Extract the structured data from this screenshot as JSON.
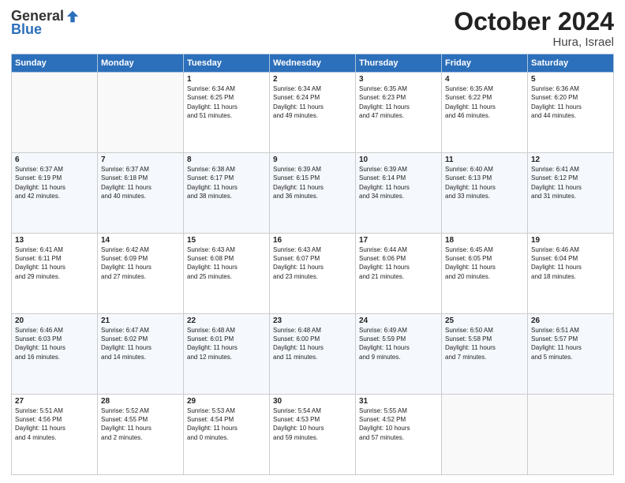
{
  "logo": {
    "general": "General",
    "blue": "Blue"
  },
  "title": "October 2024",
  "location": "Hura, Israel",
  "days_header": [
    "Sunday",
    "Monday",
    "Tuesday",
    "Wednesday",
    "Thursday",
    "Friday",
    "Saturday"
  ],
  "weeks": [
    [
      {
        "day": "",
        "content": ""
      },
      {
        "day": "",
        "content": ""
      },
      {
        "day": "1",
        "content": "Sunrise: 6:34 AM\nSunset: 6:25 PM\nDaylight: 11 hours\nand 51 minutes."
      },
      {
        "day": "2",
        "content": "Sunrise: 6:34 AM\nSunset: 6:24 PM\nDaylight: 11 hours\nand 49 minutes."
      },
      {
        "day": "3",
        "content": "Sunrise: 6:35 AM\nSunset: 6:23 PM\nDaylight: 11 hours\nand 47 minutes."
      },
      {
        "day": "4",
        "content": "Sunrise: 6:35 AM\nSunset: 6:22 PM\nDaylight: 11 hours\nand 46 minutes."
      },
      {
        "day": "5",
        "content": "Sunrise: 6:36 AM\nSunset: 6:20 PM\nDaylight: 11 hours\nand 44 minutes."
      }
    ],
    [
      {
        "day": "6",
        "content": "Sunrise: 6:37 AM\nSunset: 6:19 PM\nDaylight: 11 hours\nand 42 minutes."
      },
      {
        "day": "7",
        "content": "Sunrise: 6:37 AM\nSunset: 6:18 PM\nDaylight: 11 hours\nand 40 minutes."
      },
      {
        "day": "8",
        "content": "Sunrise: 6:38 AM\nSunset: 6:17 PM\nDaylight: 11 hours\nand 38 minutes."
      },
      {
        "day": "9",
        "content": "Sunrise: 6:39 AM\nSunset: 6:15 PM\nDaylight: 11 hours\nand 36 minutes."
      },
      {
        "day": "10",
        "content": "Sunrise: 6:39 AM\nSunset: 6:14 PM\nDaylight: 11 hours\nand 34 minutes."
      },
      {
        "day": "11",
        "content": "Sunrise: 6:40 AM\nSunset: 6:13 PM\nDaylight: 11 hours\nand 33 minutes."
      },
      {
        "day": "12",
        "content": "Sunrise: 6:41 AM\nSunset: 6:12 PM\nDaylight: 11 hours\nand 31 minutes."
      }
    ],
    [
      {
        "day": "13",
        "content": "Sunrise: 6:41 AM\nSunset: 6:11 PM\nDaylight: 11 hours\nand 29 minutes."
      },
      {
        "day": "14",
        "content": "Sunrise: 6:42 AM\nSunset: 6:09 PM\nDaylight: 11 hours\nand 27 minutes."
      },
      {
        "day": "15",
        "content": "Sunrise: 6:43 AM\nSunset: 6:08 PM\nDaylight: 11 hours\nand 25 minutes."
      },
      {
        "day": "16",
        "content": "Sunrise: 6:43 AM\nSunset: 6:07 PM\nDaylight: 11 hours\nand 23 minutes."
      },
      {
        "day": "17",
        "content": "Sunrise: 6:44 AM\nSunset: 6:06 PM\nDaylight: 11 hours\nand 21 minutes."
      },
      {
        "day": "18",
        "content": "Sunrise: 6:45 AM\nSunset: 6:05 PM\nDaylight: 11 hours\nand 20 minutes."
      },
      {
        "day": "19",
        "content": "Sunrise: 6:46 AM\nSunset: 6:04 PM\nDaylight: 11 hours\nand 18 minutes."
      }
    ],
    [
      {
        "day": "20",
        "content": "Sunrise: 6:46 AM\nSunset: 6:03 PM\nDaylight: 11 hours\nand 16 minutes."
      },
      {
        "day": "21",
        "content": "Sunrise: 6:47 AM\nSunset: 6:02 PM\nDaylight: 11 hours\nand 14 minutes."
      },
      {
        "day": "22",
        "content": "Sunrise: 6:48 AM\nSunset: 6:01 PM\nDaylight: 11 hours\nand 12 minutes."
      },
      {
        "day": "23",
        "content": "Sunrise: 6:48 AM\nSunset: 6:00 PM\nDaylight: 11 hours\nand 11 minutes."
      },
      {
        "day": "24",
        "content": "Sunrise: 6:49 AM\nSunset: 5:59 PM\nDaylight: 11 hours\nand 9 minutes."
      },
      {
        "day": "25",
        "content": "Sunrise: 6:50 AM\nSunset: 5:58 PM\nDaylight: 11 hours\nand 7 minutes."
      },
      {
        "day": "26",
        "content": "Sunrise: 6:51 AM\nSunset: 5:57 PM\nDaylight: 11 hours\nand 5 minutes."
      }
    ],
    [
      {
        "day": "27",
        "content": "Sunrise: 5:51 AM\nSunset: 4:56 PM\nDaylight: 11 hours\nand 4 minutes."
      },
      {
        "day": "28",
        "content": "Sunrise: 5:52 AM\nSunset: 4:55 PM\nDaylight: 11 hours\nand 2 minutes."
      },
      {
        "day": "29",
        "content": "Sunrise: 5:53 AM\nSunset: 4:54 PM\nDaylight: 11 hours\nand 0 minutes."
      },
      {
        "day": "30",
        "content": "Sunrise: 5:54 AM\nSunset: 4:53 PM\nDaylight: 10 hours\nand 59 minutes."
      },
      {
        "day": "31",
        "content": "Sunrise: 5:55 AM\nSunset: 4:52 PM\nDaylight: 10 hours\nand 57 minutes."
      },
      {
        "day": "",
        "content": ""
      },
      {
        "day": "",
        "content": ""
      }
    ]
  ]
}
